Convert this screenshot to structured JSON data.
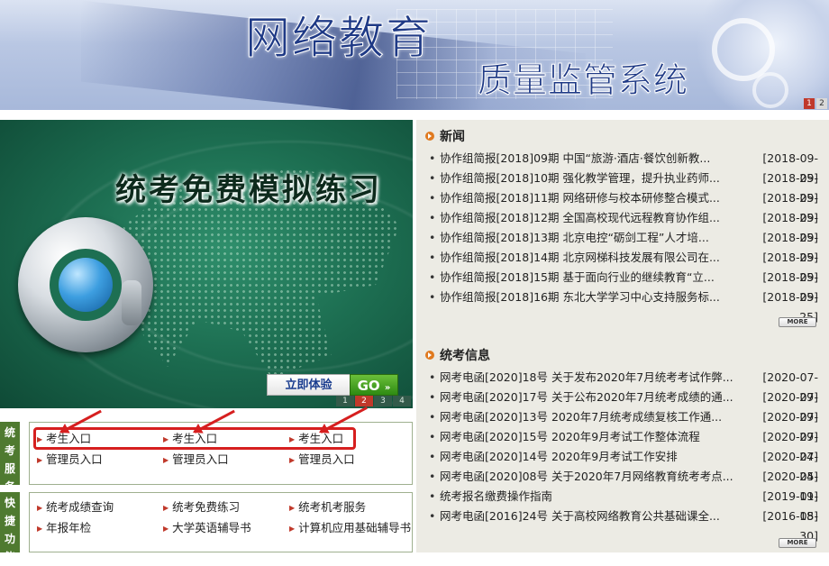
{
  "banner": {
    "title": "网络教育",
    "subtitle": "质量监管系统",
    "pager": [
      "1",
      "2"
    ],
    "active_page": "1"
  },
  "promo": {
    "title": "统考免费模拟练习",
    "try_label": "立即体验",
    "go_label": "GO",
    "pager": [
      "1",
      "2",
      "3",
      "4"
    ],
    "active_page": "2"
  },
  "exam_service": {
    "label": "统考服务",
    "row1": [
      "考生入口",
      "考生入口",
      "考生入口"
    ],
    "row2": [
      "管理员入口",
      "管理员入口",
      "管理员入口"
    ]
  },
  "quick": {
    "label": "快捷功能",
    "row1": [
      "统考成绩查询",
      "统考免费练习",
      "统考机考服务"
    ],
    "row2": [
      "年报年检",
      "大学英语辅导书",
      "计算机应用基础辅导书"
    ]
  },
  "news": {
    "title": "新闻",
    "more": "MORE",
    "items": [
      {
        "text": "协作组简报[2018]09期 中国“旅游·酒店·餐饮创新教...",
        "date": "[2018-09-25]"
      },
      {
        "text": "协作组简报[2018]10期 强化教学管理，提升执业药师...",
        "date": "[2018-09-25]"
      },
      {
        "text": "协作组简报[2018]11期 网络研修与校本研修整合模式...",
        "date": "[2018-09-25]"
      },
      {
        "text": "协作组简报[2018]12期 全国高校现代远程教育协作组...",
        "date": "[2018-09-25]"
      },
      {
        "text": "协作组简报[2018]13期 北京电控“砺剑工程”人才培...",
        "date": "[2018-09-25]"
      },
      {
        "text": "协作组简报[2018]14期 北京网梯科技发展有限公司在...",
        "date": "[2018-09-25]"
      },
      {
        "text": "协作组简报[2018]15期 基于面向行业的继续教育“立...",
        "date": "[2018-09-25]"
      },
      {
        "text": "协作组简报[2018]16期 东北大学学习中心支持服务标...",
        "date": "[2018-09-25]"
      }
    ]
  },
  "exam_info": {
    "title": "统考信息",
    "more": "MORE",
    "items": [
      {
        "text": "网考电函[2020]18号 关于发布2020年7月统考考试作弊...",
        "date": "[2020-07-29]"
      },
      {
        "text": "网考电函[2020]17号 关于公布2020年7月统考成绩的通...",
        "date": "[2020-07-29]"
      },
      {
        "text": "网考电函[2020]13号 2020年7月统考成绩复核工作通...",
        "date": "[2020-07-29]"
      },
      {
        "text": "网考电函[2020]15号 2020年9月考试工作整体流程",
        "date": "[2020-07-24]"
      },
      {
        "text": "网考电函[2020]14号 2020年9月考试工作安排",
        "date": "[2020-07-24]"
      },
      {
        "text": "网考电函[2020]08号 关于2020年7月网络教育统考考点...",
        "date": "[2020-05-19]"
      },
      {
        "text": "统考报名缴费操作指南",
        "date": "[2019-01-18]"
      },
      {
        "text": "网考电函[2016]24号 关于高校网络教育公共基础课全...",
        "date": "[2016-05-30]"
      }
    ]
  },
  "colors": {
    "accent_red": "#d61f1f",
    "section_green": "#4f7a30",
    "right_bg": "#ecebe4"
  }
}
